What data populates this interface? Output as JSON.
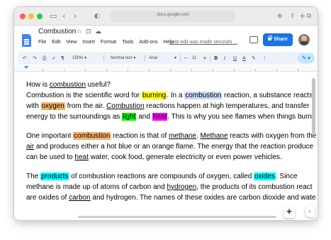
{
  "browser": {
    "url": "docs.google.com",
    "icons": [
      "sidebar-icon",
      "back-icon",
      "forward-icon",
      "shield-icon",
      "download-icon",
      "share-icon",
      "new-tab-icon",
      "tabs-icon"
    ]
  },
  "docs": {
    "title": "Combustion",
    "menu": [
      "File",
      "Edit",
      "View",
      "Insert",
      "Format",
      "Tools",
      "Add-ons",
      "Help"
    ],
    "last_edit": "Last edit was made seconds ...",
    "share_label": "Share"
  },
  "toolbar": {
    "zoom": "150%",
    "style": "Normal text",
    "font": "Arial",
    "font_size": "11",
    "minus": "−",
    "plus": "+",
    "bold": "B",
    "italic": "I",
    "underline": "U",
    "text_color": "A",
    "pencil": "✎ ▾"
  },
  "document": {
    "p1_l1_a": "How is ",
    "p1_l1_b": "combustion",
    "p1_l1_c": " useful?",
    "p1_l2_a": "Combustion is the scientific word for ",
    "p1_l2_b": "burning",
    "p1_l2_c": ". In a ",
    "p1_l2_d": "combustion",
    "p1_l2_e": " reaction, a substance reacts",
    "p1_l3_a": "with ",
    "p1_l3_b": "oxygen",
    "p1_l3_c": " from the air. ",
    "p1_l3_d": "Combustion",
    "p1_l3_e": " reactions happen at high temperatures, and transfer",
    "p1_l4_a": "energy to the surroundings as ",
    "p1_l4_b": "light",
    "p1_l4_c": " and ",
    "p1_l4_d": "heat",
    "p1_l4_e": ". This is why you see flames when things burn.",
    "p2_l1_a": "One important ",
    "p2_l1_b": "combustion",
    "p2_l1_c": " reaction is that of ",
    "p2_l1_d": "methane",
    "p2_l1_e": ". ",
    "p2_l1_f": "Methane",
    "p2_l1_g": " reacts with oxygen from the",
    "p2_l2_a": "air",
    "p2_l2_b": " and produces either a hot blue or an orange flame. The energy that the reaction produce",
    "p2_l3_a": "can be used to ",
    "p2_l3_b": "heat",
    "p2_l3_c": " water, cook food, generate electricity or even power vehicles.",
    "p3_l1_a": "The ",
    "p3_l1_b": "products",
    "p3_l1_c": " of combustion reactions are compounds of oxygen, called ",
    "p3_l1_d": "oxides",
    "p3_l1_e": ". Since",
    "p3_l2_a": "methane is made up of atoms of carbon and ",
    "p3_l2_b": "hydrogen",
    "p3_l2_c": ", the products of its combustion react",
    "p3_l3_a": "are oxides of ",
    "p3_l3_b": "carbon",
    "p3_l3_c": " and hydrogen. The names of these oxides are carbon dioxide and wate"
  },
  "colors": {
    "share_blue": "#1a73e8",
    "highlight_yellow": "#ffff00",
    "highlight_blue": "#c9daf8",
    "highlight_orange": "#f6b26b",
    "highlight_green": "#00ff00",
    "highlight_magenta": "#ff00ff",
    "highlight_cyan": "#00ffff"
  }
}
